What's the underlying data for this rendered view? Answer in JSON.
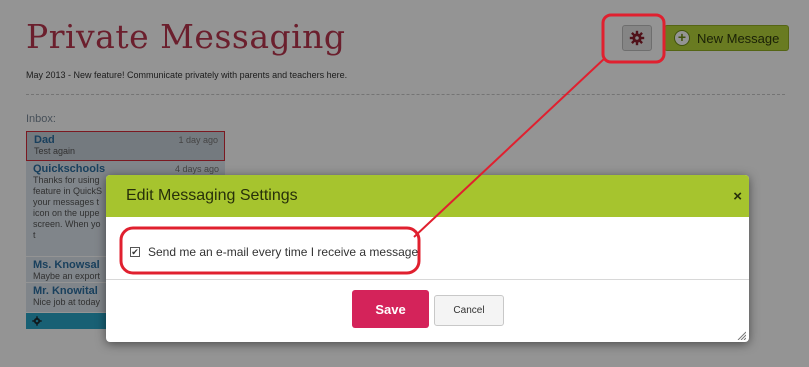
{
  "page": {
    "title": "Private Messaging",
    "subtitle": "May 2013 - New feature! Communicate privately with parents and teachers here.",
    "inbox_label": "Inbox:"
  },
  "toolbar": {
    "settings_icon": "gear-icon",
    "new_message_label": "New Message",
    "new_message_icon": "plus-circle-icon"
  },
  "messages": [
    {
      "sender": "Dad",
      "time": "1 day ago",
      "snippet": "Test again"
    },
    {
      "sender": "Quickschools",
      "time": "4 days ago",
      "snippet": "Thanks for using feature in QuickS your messages t icon on the uppe screen. When yo t"
    },
    {
      "sender": "Ms. Knowsal",
      "time": "",
      "snippet": "Maybe an export"
    },
    {
      "sender": "Mr. Knowital",
      "time": "",
      "snippet": "Nice job at today"
    }
  ],
  "modal": {
    "title": "Edit Messaging Settings",
    "close_label": "×",
    "email_option_label": "Send me an e-mail every time I receive a message.",
    "email_option_checked": true,
    "save_label": "Save",
    "cancel_label": "Cancel"
  },
  "colors": {
    "brand_title": "#b8364f",
    "header_green": "#a6c42e",
    "save_pink": "#d4235a",
    "highlight_red": "#e0202f"
  }
}
